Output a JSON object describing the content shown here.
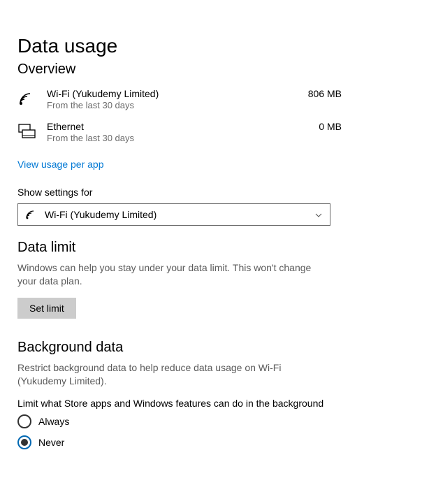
{
  "page": {
    "title": "Data usage"
  },
  "overview": {
    "heading": "Overview",
    "items": [
      {
        "name": "Wi-Fi (Yukudemy Limited)",
        "sub": "From the last 30 days",
        "amount": "806 MB",
        "icon": "wifi"
      },
      {
        "name": "Ethernet",
        "sub": "From the last 30 days",
        "amount": "0 MB",
        "icon": "ethernet"
      }
    ],
    "viewPerApp": "View usage per app"
  },
  "settingsFor": {
    "label": "Show settings for",
    "selected": "Wi-Fi (Yukudemy Limited)"
  },
  "dataLimit": {
    "heading": "Data limit",
    "desc": "Windows can help you stay under your data limit. This won't change your data plan.",
    "button": "Set limit"
  },
  "background": {
    "heading": "Background data",
    "desc": "Restrict background data to help reduce data usage on Wi-Fi (Yukudemy Limited).",
    "question": "Limit what Store apps and Windows features can do in the background",
    "options": {
      "always": "Always",
      "never": "Never"
    },
    "selected": "never"
  }
}
